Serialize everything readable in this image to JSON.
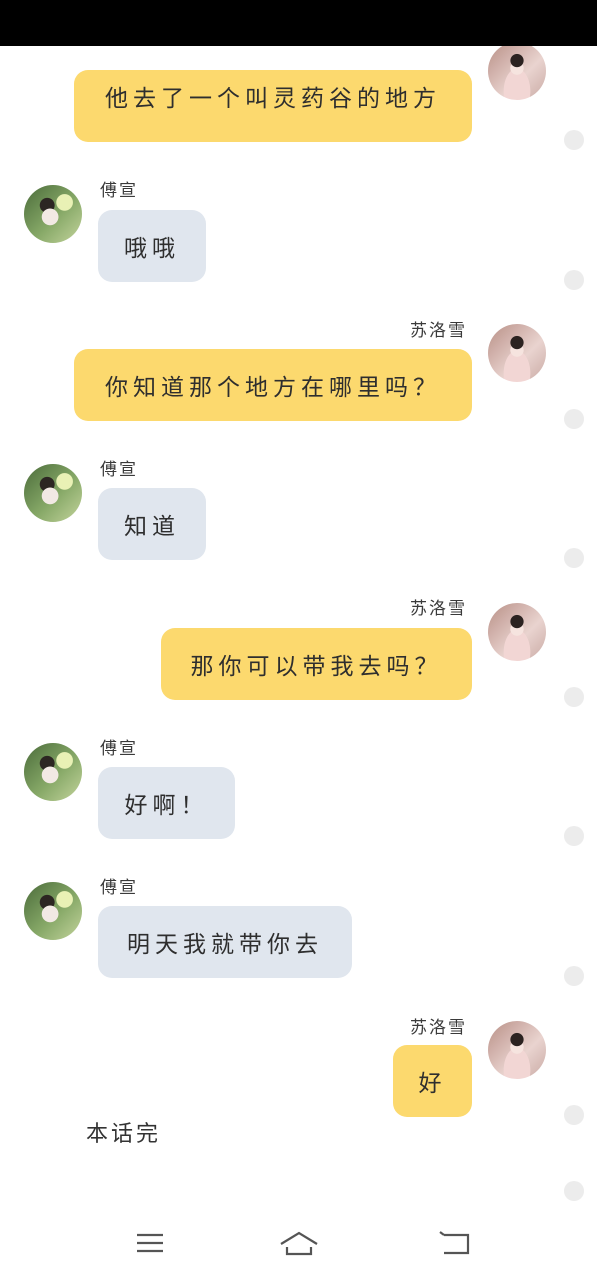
{
  "names": {
    "left": "傅宣",
    "right": "苏洛雪"
  },
  "messages": [
    {
      "side": "right",
      "text": "他去了一个叫灵药谷的地方"
    },
    {
      "side": "left",
      "name": "傅宣",
      "text": "哦哦"
    },
    {
      "side": "right",
      "name": "苏洛雪",
      "text": "你知道那个地方在哪里吗？"
    },
    {
      "side": "left",
      "name": "傅宣",
      "text": "知道"
    },
    {
      "side": "right",
      "name": "苏洛雪",
      "text": "那你可以带我去吗？"
    },
    {
      "side": "left",
      "name": "傅宣",
      "text": "好啊！"
    },
    {
      "side": "left",
      "name": "傅宣",
      "text": "明天我就带你去"
    },
    {
      "side": "right",
      "name": "苏洛雪",
      "text": "好"
    }
  ],
  "end_text": "本话完",
  "colors": {
    "left_bubble": "#e0e6ee",
    "right_bubble": "#fcd96e",
    "status_bar": "#000000"
  },
  "nav": {
    "icons": [
      "menu-icon",
      "home-icon",
      "back-icon"
    ]
  }
}
